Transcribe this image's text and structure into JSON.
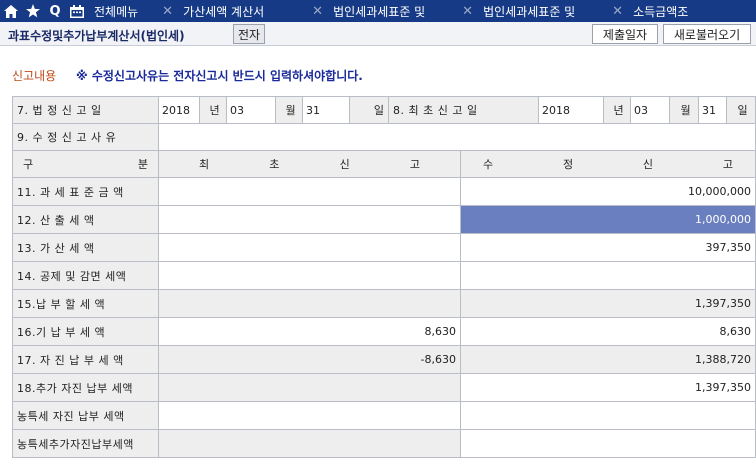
{
  "nav": {
    "menu_label": "전체메뉴",
    "tabs": [
      "가산세액 계산서",
      "법인세과세표준 및",
      "법인세과세표준 및",
      "소득금액조"
    ]
  },
  "titlebar": {
    "title": "과표수정및추가납부계산서(법인세)",
    "jeonja_label": "전자",
    "submit_date_label": "제출일자",
    "reload_label": "새로불러오기"
  },
  "notice": {
    "label": "신고내용",
    "text": "※ 수정신고사유는 전자신고시 반드시 입력하셔야합니다."
  },
  "form": {
    "row7": {
      "label": "7. 법 정 신 고 일",
      "year": "2018",
      "year_unit": "년",
      "month": "03",
      "month_unit": "월",
      "day": "31",
      "day_unit": "일",
      "label8": "8. 최 초 신 고 일",
      "year8": "2018",
      "month8": "03",
      "day8": "31"
    },
    "row9_label": "9. 수 정 신 고 사 유",
    "header": {
      "gubun": [
        "구",
        "분"
      ],
      "initial": [
        "최",
        "초",
        "신",
        "고"
      ],
      "amended": [
        "수",
        "정",
        "신",
        "고"
      ]
    },
    "rows": [
      {
        "label": "11. 과 세 표 준 금 액",
        "initial": "",
        "amended": "10,000,000"
      },
      {
        "label": "12. 산   출   세   액",
        "initial": "",
        "amended": "1,000,000"
      },
      {
        "label": "13. 가   산   세   액",
        "initial": "",
        "amended": "397,350"
      },
      {
        "label": "14. 공제 및 감면 세액",
        "initial": "",
        "amended": ""
      },
      {
        "label": "15.납 부 할 세 액",
        "initial": "",
        "amended": "1,397,350"
      },
      {
        "label": "16.기  납  부  세  액",
        "initial": "8,630",
        "amended": "8,630"
      },
      {
        "label": "17. 자 진 납 부 세 액",
        "initial": "-8,630",
        "amended": "1,388,720"
      },
      {
        "label": "18.추가 자진 납부 세액",
        "initial": "",
        "amended": "1,397,350"
      },
      {
        "label": "농특세 자진 납부 세액",
        "initial": "",
        "amended": ""
      },
      {
        "label": "농특세추가자진납부세액",
        "initial": "",
        "amended": ""
      }
    ]
  }
}
